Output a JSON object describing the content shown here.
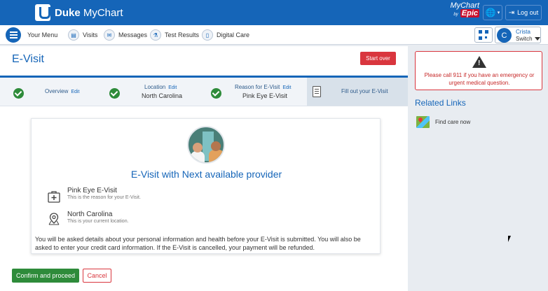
{
  "header": {
    "brand": "Duke",
    "brand_suffix": " MyChart",
    "mychart_label": "MyChart",
    "by_label": "by",
    "epic_label": "Epic",
    "logout_label": "Log out"
  },
  "menubar": {
    "your_menu": "Your Menu",
    "items": [
      {
        "label": "Visits",
        "icon": "visits-icon"
      },
      {
        "label": "Messages",
        "icon": "messages-icon"
      },
      {
        "label": "Test Results",
        "icon": "test-results-icon"
      },
      {
        "label": "Digital Care",
        "icon": "digital-care-icon"
      }
    ],
    "user": {
      "initial": "C",
      "name": "Crista",
      "switch_label": "Switch"
    }
  },
  "main": {
    "title": "E-Visit",
    "start_over": "Start over",
    "steps": [
      {
        "label": "Overview",
        "edit": "Edit",
        "value": ""
      },
      {
        "label": "Location",
        "edit": "Edit",
        "value": "North Carolina"
      },
      {
        "label": "Reason for E-Visit",
        "edit": "Edit",
        "value": "Pink Eye E-Visit"
      }
    ],
    "current_step": "Fill out your E-Visit",
    "card": {
      "heading": "E-Visit with Next available provider",
      "reason_title": "Pink Eye E-Visit",
      "reason_sub": "This is the reason for your E-Visit.",
      "location_title": "North Carolina",
      "location_sub": "This is your current location.",
      "note": "You will be asked details about your personal information and health before your E-Visit is submitted. You will also be asked to enter your credit card information. If the E-Visit is cancelled, your payment will be refunded."
    },
    "confirm_label": "Confirm and proceed",
    "cancel_label": "Cancel"
  },
  "sidebar": {
    "alert_text": "Please call 911 if you have an emergency or urgent medical question.",
    "related_title": "Related Links",
    "find_care": "Find care now"
  },
  "colors": {
    "brand_blue": "#1565b8",
    "success_green": "#2e8b3a",
    "danger_red": "#d9363e"
  }
}
